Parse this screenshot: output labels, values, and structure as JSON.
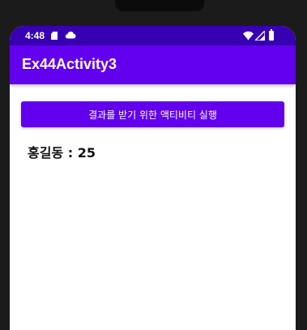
{
  "status_bar": {
    "time": "4:48",
    "icons": [
      "sd-card-icon",
      "cloud-icon",
      "wifi-icon",
      "signal-icon",
      "battery-icon"
    ]
  },
  "app_bar": {
    "title": "Ex44Activity3"
  },
  "main": {
    "button_label": "결과를 받기 위한 액티비티 실행",
    "result_text": "홍길동 : 25"
  },
  "colors": {
    "status_bar": "#3700b3",
    "primary": "#6200ee",
    "background": "#ffffff",
    "device_frame": "#1b1b1c"
  }
}
